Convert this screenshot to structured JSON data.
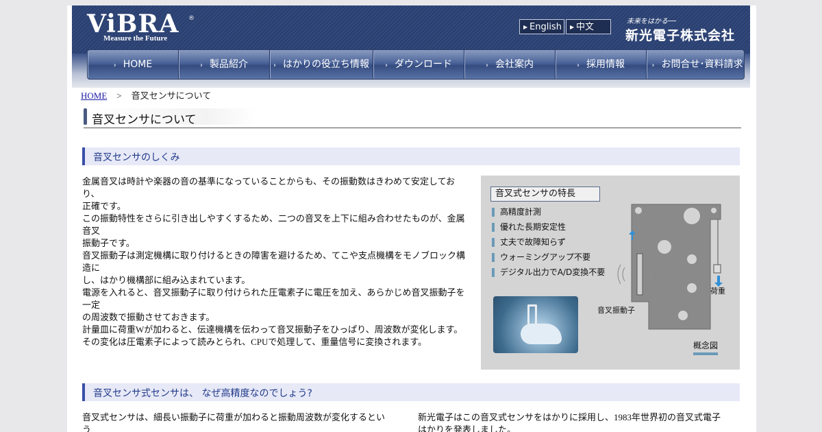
{
  "header": {
    "logo": "ViBRA",
    "logo_reg": "®",
    "logo_sub": "Measure the Future",
    "lang_english": "English",
    "lang_chinese": "中文",
    "company_tag": "未来をはかる──",
    "company_name": "新光電子株式会社"
  },
  "nav": {
    "items": [
      {
        "label": "HOME"
      },
      {
        "label": "製品紹介"
      },
      {
        "label": "はかりの役立ち情報"
      },
      {
        "label": "ダウンロード"
      },
      {
        "label": "会社案内"
      },
      {
        "label": "採用情報"
      },
      {
        "label": "お問合せ･資料請求"
      }
    ]
  },
  "breadcrumb": {
    "home": "HOME",
    "separator": ">",
    "current": "音叉センサについて"
  },
  "page_title": "音叉センサについて",
  "section1": {
    "heading": "音叉センサのしくみ",
    "lines": [
      "金属音叉は時計や楽器の音の基準になっていることからも、その振動数はきわめて安定してお",
      "り、",
      "正確です。",
      "この振動特性をさらに引き出しやすくするため、二つの音叉を上下に組み合わせたものが、金属",
      "音叉",
      "振動子です。",
      "音叉振動子は測定機構に取り付けるときの障害を避けるため、てこや支点機構をモノブロック構",
      "造に",
      "し、はかり機構部に組み込まれています。",
      "電源を入れると、音叉振動子に取り付けられた圧電素子に電圧を加え、あらかじめ音叉振動子を",
      "一定",
      "の周波数で振動させておきます。",
      "計量皿に荷重Wが加わると、伝達機構を伝わって音叉振動子をひっぱり、周波数が変化します。",
      "その変化は圧電素子によって読みとられ、CPUで処理して、重量信号に変換されます。"
    ]
  },
  "figure": {
    "title": "音叉式センサの特長",
    "features": [
      "高精度計測",
      "優れた長期安定性",
      "丈夫で故障知らず",
      "ウォーミングアップ不要",
      "デジタル出力でA/D変換不要"
    ],
    "label_vibrator": "音叉振動子",
    "label_load": "荷重",
    "caption": "概念図"
  },
  "section2": {
    "heading": "音叉センサ式センサは、 なぜ高精度なのでしょう?",
    "left_lines": [
      "音叉式センサは、細長い振動子に荷重が加わると振動周波数が変化するとい",
      "う"
    ],
    "right_lines": [
      "新光電子はこの音叉式センサをはかりに採用し、1983年世界初の音叉式電子",
      "はかりを発表しました。"
    ]
  },
  "colors": {
    "header": "#2a3f6e",
    "nav": "#4a6399",
    "section_bg": "#e7e9f7",
    "section_accent": "#3a4fa8",
    "section_text": "#223a8a",
    "link": "#1a1aa6"
  }
}
